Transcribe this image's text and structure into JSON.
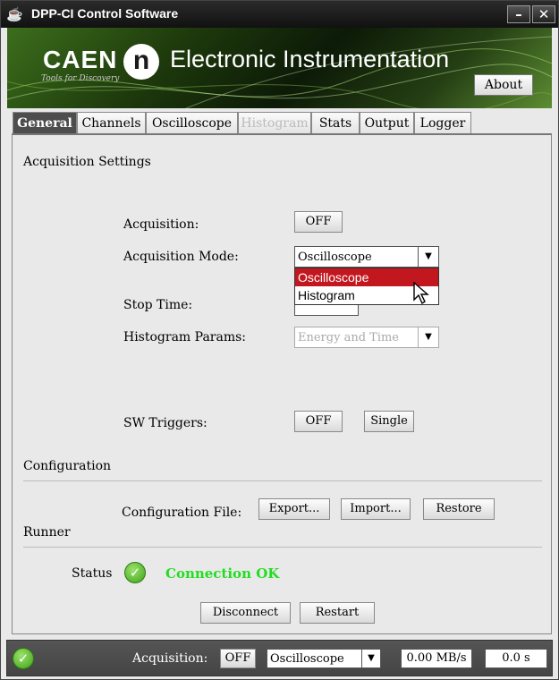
{
  "window": {
    "title": "DPP-CI Control Software"
  },
  "banner": {
    "caen": "CAEN",
    "caen_tagline": "Tools for Discovery",
    "n_logo": "n",
    "title": "Electronic Instrumentation",
    "about_label": "About"
  },
  "tabs": [
    {
      "label": "General",
      "state": "active"
    },
    {
      "label": "Channels",
      "state": "normal"
    },
    {
      "label": "Oscilloscope",
      "state": "normal"
    },
    {
      "label": "Histogram",
      "state": "disabled"
    },
    {
      "label": "Stats",
      "state": "normal"
    },
    {
      "label": "Output",
      "state": "normal"
    },
    {
      "label": "Logger",
      "state": "normal"
    }
  ],
  "acquisition_settings": {
    "section_title": "Acquisition Settings",
    "acquisition_label": "Acquisition:",
    "acquisition_toggle": "OFF",
    "mode_label": "Acquisition Mode:",
    "mode_value": "Oscilloscope",
    "mode_options": [
      "Oscilloscope",
      "Histogram"
    ],
    "stop_time_label": "Stop Time:",
    "histogram_params_label": "Histogram Params:",
    "histogram_params_value": "Energy and Time",
    "sw_triggers_label": "SW Triggers:",
    "sw_triggers_toggle": "OFF",
    "single_label": "Single"
  },
  "configuration": {
    "section_title": "Configuration",
    "file_label": "Configuration File:",
    "export_label": "Export...",
    "import_label": "Import...",
    "restore_label": "Restore"
  },
  "runner": {
    "section_title": "Runner",
    "status_label": "Status",
    "status_text": "Connection OK",
    "disconnect_label": "Disconnect",
    "restart_label": "Restart"
  },
  "status_bar": {
    "acquisition_label": "Acquisition:",
    "acquisition_toggle": "OFF",
    "mode_value": "Oscilloscope",
    "rate": "0.00 MB/s",
    "time": "0.0 s"
  },
  "colors": {
    "accent_selected": "#c2171f",
    "status_ok": "#22dd22"
  }
}
